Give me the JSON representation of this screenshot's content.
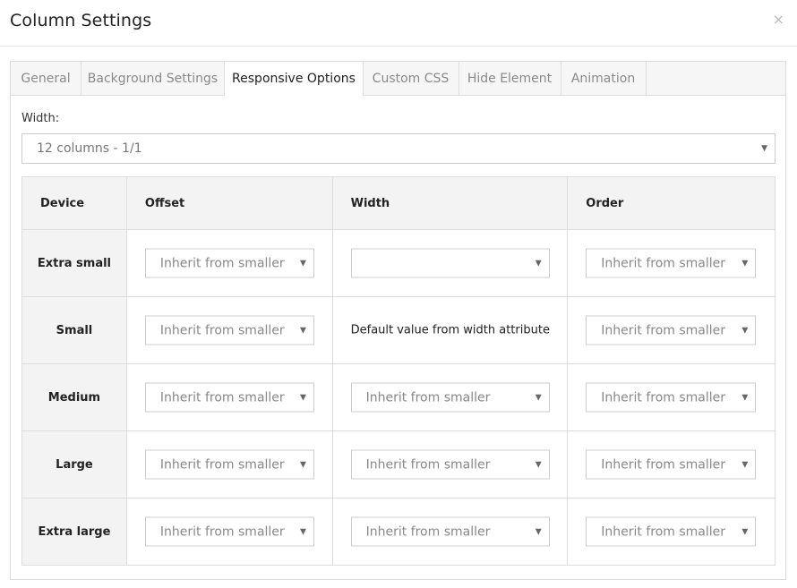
{
  "dialog": {
    "title": "Column Settings",
    "close_glyph": "×"
  },
  "tabs": [
    {
      "label": "General"
    },
    {
      "label": "Background Settings"
    },
    {
      "label": "Responsive Options",
      "active": true
    },
    {
      "label": "Custom CSS"
    },
    {
      "label": "Hide Element"
    },
    {
      "label": "Animation"
    }
  ],
  "width_field": {
    "label": "Width:",
    "value": "12 columns - 1/1"
  },
  "table": {
    "headers": {
      "device": "Device",
      "offset": "Offset",
      "width": "Width",
      "order": "Order"
    },
    "rows": [
      {
        "device": "Extra small",
        "offset": "Inherit from smaller",
        "width": "",
        "order": "Inherit from smaller"
      },
      {
        "device": "Small",
        "offset": "Inherit from smaller",
        "width_text": "Default value from width attribute",
        "order": "Inherit from smaller"
      },
      {
        "device": "Medium",
        "offset": "Inherit from smaller",
        "width": "Inherit from smaller",
        "order": "Inherit from smaller"
      },
      {
        "device": "Large",
        "offset": "Inherit from smaller",
        "width": "Inherit from smaller",
        "order": "Inherit from smaller"
      },
      {
        "device": "Extra large",
        "offset": "Inherit from smaller",
        "width": "Inherit from smaller",
        "order": "Inherit from smaller"
      }
    ]
  },
  "icons": {
    "caret": "caret-down-icon",
    "close": "close-icon"
  }
}
